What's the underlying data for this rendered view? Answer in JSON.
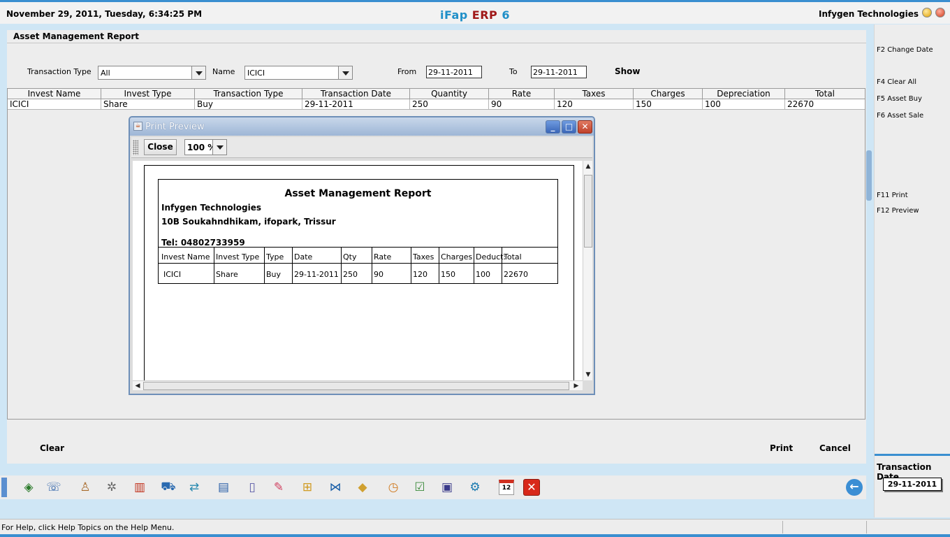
{
  "header": {
    "datetime": "November  29, 2011, Tuesday, 6:34:25 PM",
    "brand_prefix": "iFap ",
    "brand_erp": "ERP",
    "brand_version": " 6",
    "company": "Infygen Technologies"
  },
  "report": {
    "title": "Asset Management Report",
    "filters": {
      "transaction_type_label": "Transaction Type",
      "transaction_type_value": "All",
      "name_label": "Name",
      "name_value": "ICICI",
      "from_label": "From",
      "from_value": "29-11-2011",
      "to_label": "To",
      "to_value": "29-11-2011",
      "show_label": "Show"
    },
    "columns": [
      "Invest Name",
      "Invest Type",
      "Transaction Type",
      "Transaction Date",
      "Quantity",
      "Rate",
      "Taxes",
      "Charges",
      "Depreciation",
      "Total"
    ],
    "rows": [
      [
        "ICICI",
        "Share",
        "Buy",
        "29-11-2011",
        "250",
        "90",
        "120",
        "150",
        "100",
        "22670"
      ]
    ],
    "clear_label": "Clear",
    "print_label": "Print",
    "cancel_label": "Cancel"
  },
  "shortcuts": {
    "f2": "F2 Change Date",
    "f4": "F4 Clear All",
    "f5": "F5 Asset Buy",
    "f6": "F6 Asset Sale",
    "f11": "F11 Print",
    "f12": "F12 Preview"
  },
  "transaction_date": {
    "label": "Transaction Date",
    "value": "29-11-2011"
  },
  "dialog": {
    "title": "Print Preview",
    "close_label": "Close",
    "zoom": "100 %",
    "report": {
      "title": "Asset Management Report",
      "company": "Infygen Technologies",
      "address": "10B Soukahndhikam, ifopark, Trissur",
      "tel": "Tel: 04802733959",
      "columns": [
        "Invest Name",
        "Invest Type",
        "Type",
        "Date",
        "Qty",
        "Rate",
        "Taxes",
        "Charges",
        "Deduct:",
        "Total"
      ],
      "rows": [
        [
          "ICICI",
          "Share",
          "Buy",
          "29-11-2011",
          "250",
          "90",
          "120",
          "150",
          "100",
          "22670"
        ]
      ]
    }
  },
  "toolbar_icons": [
    "map-icon",
    "customer-icon",
    "user-icon",
    "tools-icon",
    "book-icon",
    "cart-icon",
    "transfer-icon",
    "window-icon",
    "document-icon",
    "pen-icon",
    "tree-icon",
    "network-icon",
    "package-icon",
    "timer-icon",
    "checklist-icon",
    "save-icon",
    "settings-icon",
    "calendar-icon",
    "exit-icon"
  ],
  "calendar_day": "12",
  "status": "For Help, click Help Topics on the Help Menu."
}
